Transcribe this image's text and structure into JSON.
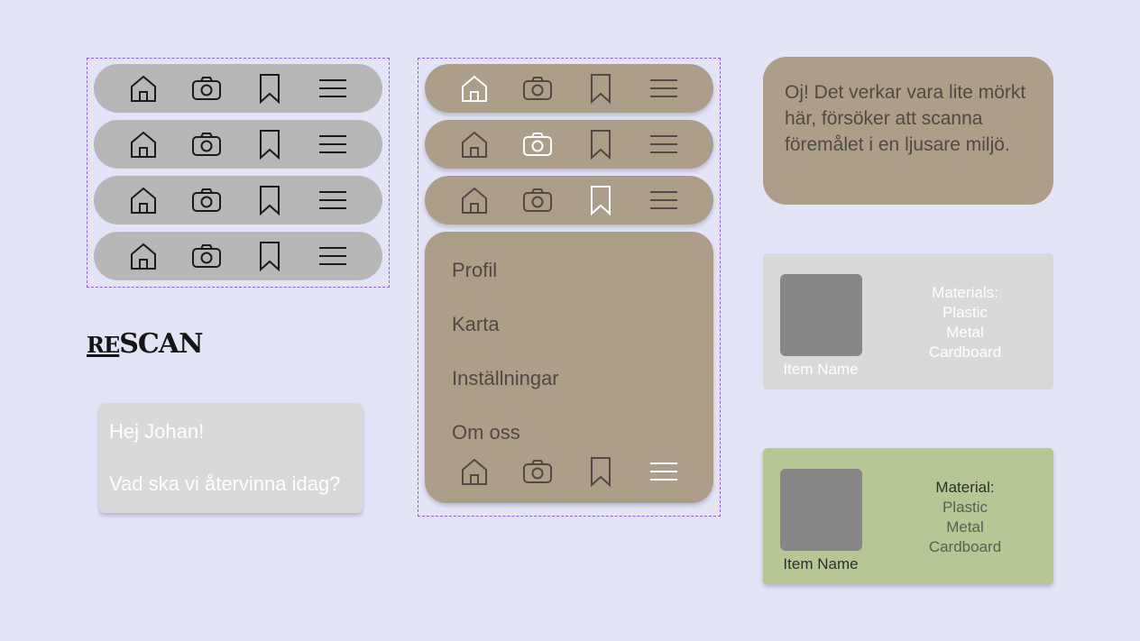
{
  "logo": {
    "re": "RE",
    "scan": "SCAN"
  },
  "greeting": {
    "line1": "Hej Johan!",
    "line2": "Vad ska vi återvinna idag?"
  },
  "nav_icons": [
    "home-icon",
    "camera-icon",
    "bookmark-icon",
    "menu-icon"
  ],
  "menu": {
    "items": [
      "Profil",
      "Karta",
      "Inställningar",
      "Om oss"
    ]
  },
  "alert": {
    "text": "Oj! Det verkar vara lite mörkt här, försöker att scanna föremålet i en ljusare miljö."
  },
  "cards": [
    {
      "name": "Item Name",
      "materials_label": "Materials:",
      "materials": [
        "Plastic",
        "Metal",
        "Cardboard"
      ]
    },
    {
      "name": "Item Name",
      "materials_label": "Material:",
      "materials": [
        "Plastic",
        "Metal",
        "Cardboard"
      ]
    }
  ],
  "colors": {
    "background": "#e4e4f9",
    "nav_gray": "#b7b7b7",
    "tan": "#ad9e89",
    "active_icon": "#ffffff",
    "icon_dark": "#1a1a1a",
    "icon_muted": "#4f4a45",
    "card_gray": "#d9d9d9",
    "card_green": "#b6c694",
    "frame": "#8b5cf6"
  }
}
